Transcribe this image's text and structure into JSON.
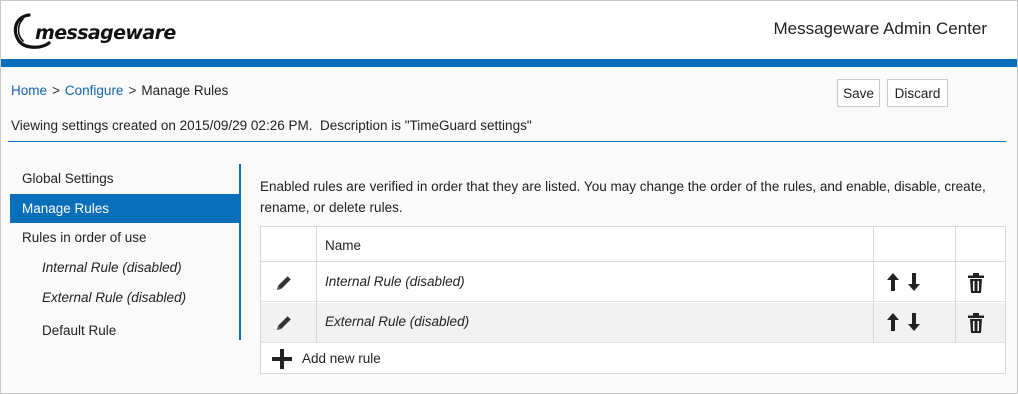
{
  "header": {
    "logo_text": "messageware",
    "app_title": "Messageware Admin Center",
    "accent_color": "#0a6fba"
  },
  "breadcrumb": {
    "home": "Home",
    "separator": ">",
    "configure": "Configure",
    "current": "Manage Rules"
  },
  "toolbar": {
    "save_label": "Save",
    "discard_label": "Discard"
  },
  "viewing_text": "Viewing settings created on 2015/09/29 02:26 PM.  Description is \"TimeGuard settings\"",
  "sidebar": {
    "items": [
      {
        "label": "Global Settings"
      },
      {
        "label": "Manage Rules",
        "active": true
      },
      {
        "label": "Rules in order of use"
      },
      {
        "label": "Internal Rule (disabled)"
      },
      {
        "label": "External Rule (disabled)"
      },
      {
        "label": "Default Rule"
      }
    ]
  },
  "main": {
    "description": "Enabled rules are verified in order that they are listed. You may change the order of the rules, and enable, disable, create, rename, or delete rules.",
    "table": {
      "column_name": "Name",
      "rows": [
        {
          "name": "Internal Rule (disabled)",
          "edit_icon": "pencil-icon",
          "move_icons": [
            "arrow-up-icon",
            "arrow-down-icon"
          ],
          "delete_icon": "trash-icon"
        },
        {
          "name": "External Rule (disabled)",
          "edit_icon": "pencil-icon",
          "move_icons": [
            "arrow-up-icon",
            "arrow-down-icon"
          ],
          "delete_icon": "trash-icon"
        }
      ],
      "add_label": "Add new rule",
      "add_icon": "plus-icon"
    }
  }
}
